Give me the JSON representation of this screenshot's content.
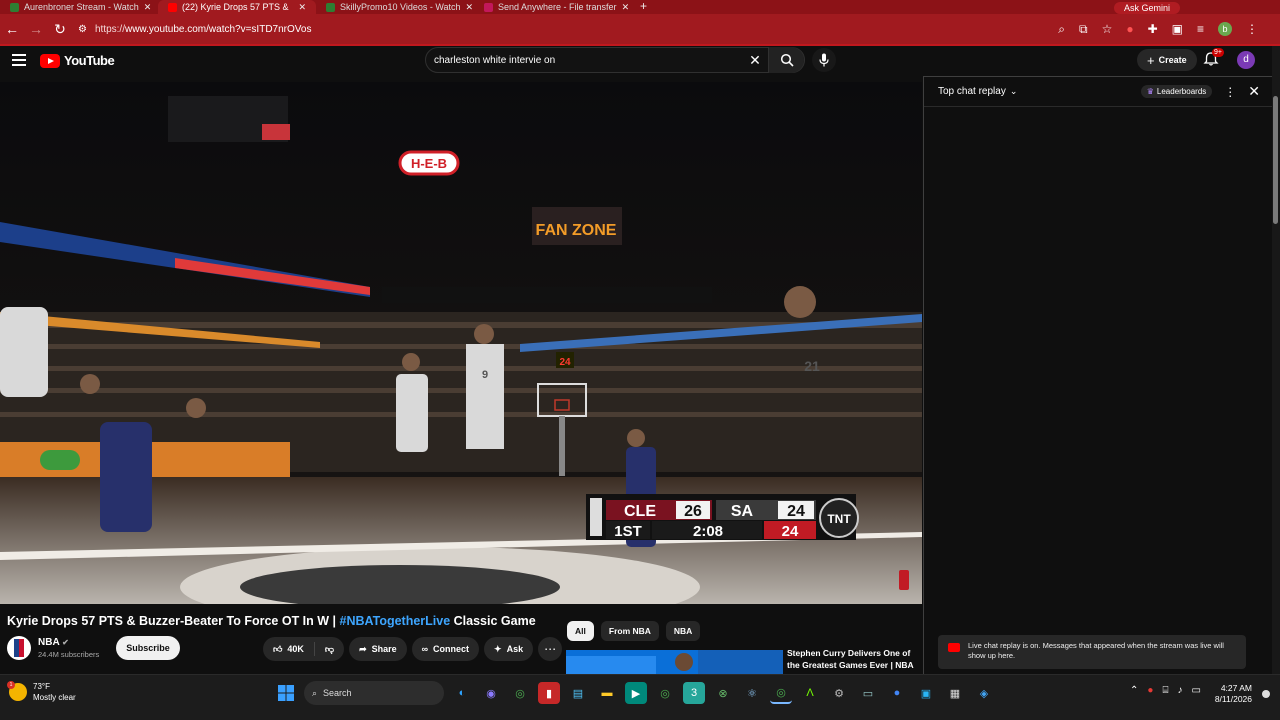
{
  "browser": {
    "tabs": [
      {
        "title": "Aurenbroner Stream - Watch",
        "color": "#2e7d32"
      },
      {
        "title": "(22) Kyrie Drops 57 PTS &",
        "color": "#ff0000"
      },
      {
        "title": "SkillyPromo10 Videos - Watch",
        "color": "#2e7d32"
      },
      {
        "title": "Send Anywhere - File transfer",
        "color": "#c2185b"
      }
    ],
    "ask_gemini": "Ask Gemini",
    "url_prefix": "https://",
    "url_main": "www.youtube.com/watch?v=sITD7nrOVos"
  },
  "youtube": {
    "logo_text": "YouTube",
    "search_value": "charleston white intervie on",
    "create_label": "Create",
    "notification_count": "9+",
    "avatar_letter": "d"
  },
  "video": {
    "scoreboard": {
      "team1": "CLE",
      "score1": "26",
      "team2": "SA",
      "score2": "24",
      "quarter": "1ST",
      "clock": "2:08",
      "shot_clock": "24",
      "network": "TNT"
    },
    "signage": {
      "heb": "H-E-B",
      "fanzone": "FAN ZONE",
      "shot_clock": "24",
      "jersey1": "21",
      "jersey2": "9"
    }
  },
  "chat": {
    "title": "Top chat replay",
    "leaderboards": "Leaderboards",
    "notice": "Live chat replay is on. Messages that appeared when the stream was live will show up here."
  },
  "details": {
    "title_main": "Kyrie Drops 57 PTS & Buzzer-Beater To Force OT In W | ",
    "title_tag": "#NBATogetherLive",
    "title_end": " Classic Game",
    "channel_name": "NBA",
    "subscribers": "24.4M subscribers",
    "subscribe_label": "Subscribe",
    "likes": "40K",
    "share_label": "Share",
    "connect_label": "Connect",
    "ask_label": "Ask"
  },
  "recommendations": {
    "chips": [
      "All",
      "From NBA",
      "NBA"
    ],
    "first_title": "Stephen Curry Delivers One of the Greatest Games Ever | NBA Classic"
  },
  "taskbar": {
    "temperature": "73°F",
    "condition": "Mostly clear",
    "search_label": "Search",
    "time": "4:27 AM",
    "date": "8/11/2026"
  }
}
